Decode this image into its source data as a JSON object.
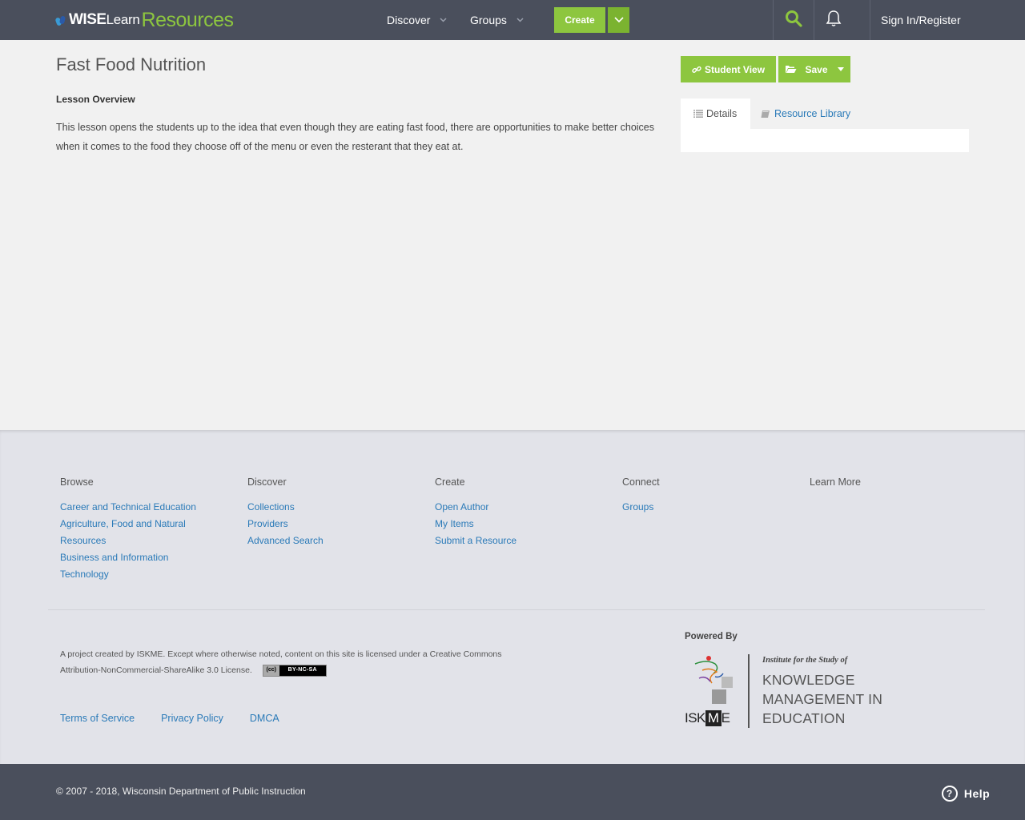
{
  "header": {
    "logo": {
      "w": "WISE",
      "learn": "Learn",
      "resources": "Resources"
    },
    "nav": [
      {
        "label": "Discover"
      },
      {
        "label": "Groups"
      }
    ],
    "create_label": "Create",
    "signin_label": "Sign In/Register",
    "icons": [
      "search-icon",
      "bell-icon",
      "chevron-down-icon"
    ]
  },
  "main": {
    "title": "Fast Food Nutrition",
    "overview_label": "Lesson Overview",
    "overview_text": "This lesson opens the students up to the idea that even though they are eating fast food, there are opportunities to make better choices when it comes to the food they choose off of the menu or even the resterant that they eat at.",
    "student_view_label": "Student View",
    "save_label": "Save",
    "tabs": [
      {
        "label": "Details",
        "active": true
      },
      {
        "label": "Resource Library",
        "active": false
      }
    ]
  },
  "footer": {
    "columns": [
      {
        "heading": "Browse",
        "links": [
          "Career and Technical Education",
          "Agriculture, Food and Natural Resources",
          "Business and Information Technology"
        ]
      },
      {
        "heading": "Discover",
        "links": [
          "Collections",
          "Providers",
          "Advanced Search"
        ]
      },
      {
        "heading": "Create",
        "links": [
          "Open Author",
          "My Items",
          "Submit a Resource"
        ]
      },
      {
        "heading": "Connect",
        "links": [
          "Groups"
        ]
      },
      {
        "heading": "Learn More",
        "links": []
      }
    ],
    "license_text": "A project created by ISKME. Except where otherwise noted, content on this site is licensed under a Creative Commons Attribution-NonCommercial-ShareAlike 3.0 License.",
    "cc_badge": "BY-NC-SA",
    "legal_links": [
      "Terms of Service",
      "Privacy Policy",
      "DMCA"
    ],
    "powered_by": "Powered By",
    "iskme": {
      "subtitle": "Institute for the Study of",
      "line1": "KNOWLEDGE",
      "line2": "MANAGEMENT IN",
      "line3": "EDUCATION",
      "wordmark_left": "ISK",
      "wordmark_mid": "M",
      "wordmark_right": "E"
    }
  },
  "bottom": {
    "copyright": "© 2007 - 2018, Wisconsin Department of Public Instruction",
    "help_label": "Help"
  },
  "colors": {
    "nav_bg": "#4a4f5c",
    "accent_green": "#8dc63f",
    "link_blue": "#2a7ab8"
  }
}
